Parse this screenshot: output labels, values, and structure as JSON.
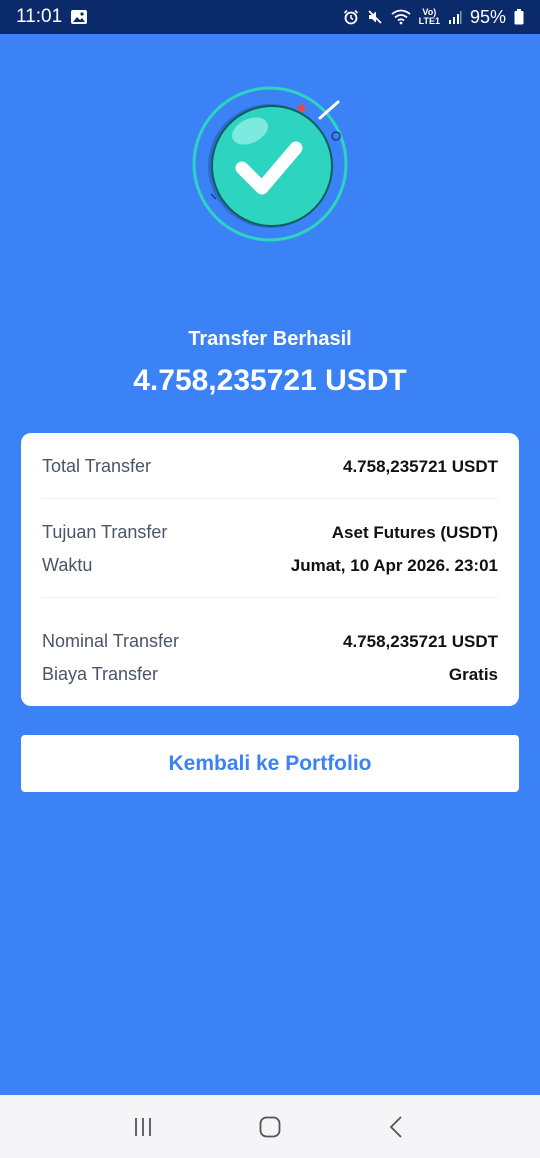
{
  "status_bar": {
    "time": "11:01",
    "network_label_top": "Vo)",
    "network_label_bottom": "LTE1",
    "battery": "95%",
    "icons": [
      "gallery-icon",
      "alarm-icon",
      "mute-icon",
      "wifi-icon",
      "signal-icon",
      "battery-icon"
    ]
  },
  "hero": {
    "icon": "success-check-icon"
  },
  "header": {
    "subtitle": "Transfer Berhasil",
    "amount": "4.758,235721 USDT"
  },
  "details": {
    "total_label": "Total Transfer",
    "total_value": "4.758,235721 USDT",
    "destination_label": "Tujuan Transfer",
    "destination_value": "Aset Futures (USDT)",
    "time_label": "Waktu",
    "time_value": "Jumat, 10 Apr 2026. 23:01",
    "nominal_label": "Nominal Transfer",
    "nominal_value": "4.758,235721 USDT",
    "fee_label": "Biaya Transfer",
    "fee_value": "Gratis"
  },
  "actions": {
    "back_label": "Kembali ke Portfolio"
  },
  "nav": {
    "icons": [
      "recent-apps-icon",
      "home-icon",
      "back-icon"
    ]
  },
  "colors": {
    "background": "#3b82f6",
    "status_bar": "#0b2a6a",
    "accent": "#3b82f6",
    "success": "#2dd4bf"
  }
}
